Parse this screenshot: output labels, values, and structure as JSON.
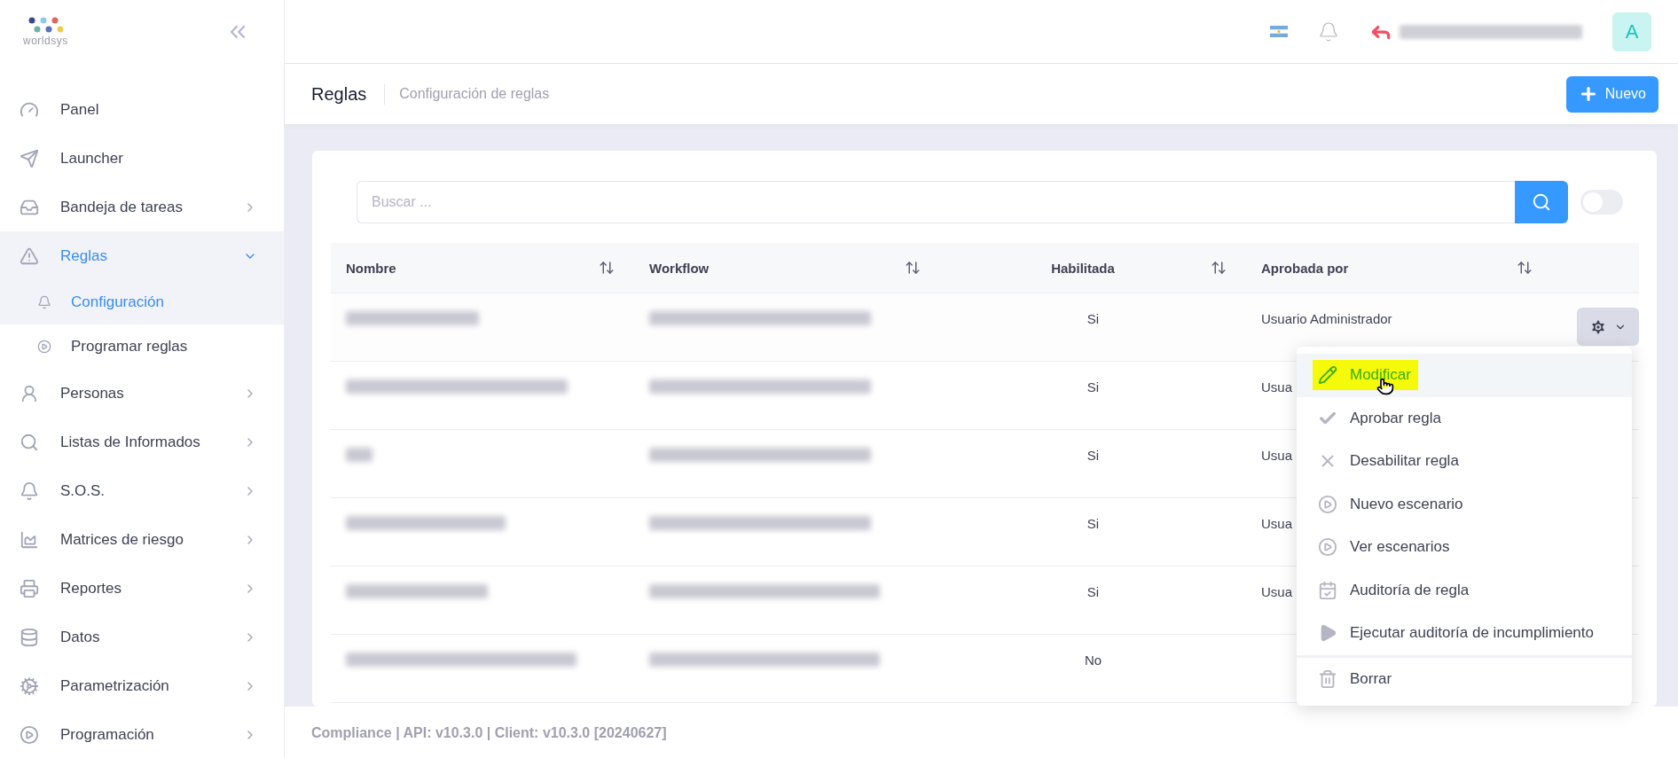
{
  "logo": {
    "text": "worldsys"
  },
  "sidebar": {
    "items": [
      {
        "label": "Panel",
        "expandable": false,
        "expanded": false,
        "selected": false
      },
      {
        "label": "Launcher",
        "expandable": false,
        "expanded": false,
        "selected": false
      },
      {
        "label": "Bandeja de tareas",
        "expandable": true,
        "expanded": false,
        "selected": false
      },
      {
        "label": "Reglas",
        "expandable": true,
        "expanded": true,
        "selected": true,
        "children": [
          {
            "label": "Configuración",
            "selected": true
          },
          {
            "label": "Programar reglas",
            "selected": false
          }
        ]
      },
      {
        "label": "Personas",
        "expandable": true,
        "expanded": false,
        "selected": false
      },
      {
        "label": "Listas de Informados",
        "expandable": true,
        "expanded": false,
        "selected": false
      },
      {
        "label": "S.O.S.",
        "expandable": true,
        "expanded": false,
        "selected": false
      },
      {
        "label": "Matrices de riesgo",
        "expandable": true,
        "expanded": false,
        "selected": false
      },
      {
        "label": "Reportes",
        "expandable": true,
        "expanded": false,
        "selected": false
      },
      {
        "label": "Datos",
        "expandable": true,
        "expanded": false,
        "selected": false
      },
      {
        "label": "Parametrización",
        "expandable": true,
        "expanded": false,
        "selected": false
      },
      {
        "label": "Programación",
        "expandable": true,
        "expanded": false,
        "selected": false
      }
    ]
  },
  "header": {
    "avatar": "A"
  },
  "page": {
    "title": "Reglas",
    "subtitle": "Configuración de reglas",
    "new_button": "Nuevo"
  },
  "search": {
    "placeholder": "Buscar ...",
    "toggle_on": false
  },
  "table": {
    "columns": [
      "Nombre",
      "Workflow",
      "Habilitada",
      "Aprobada por"
    ],
    "rows": [
      {
        "habilitada": "Si",
        "aprobada": "Usuario Administrador",
        "hovered": true
      },
      {
        "habilitada": "Si",
        "aprobada": "Usua",
        "hovered": false
      },
      {
        "habilitada": "Si",
        "aprobada": "Usua",
        "hovered": false
      },
      {
        "habilitada": "Si",
        "aprobada": "Usua",
        "hovered": false
      },
      {
        "habilitada": "Si",
        "aprobada": "Usua",
        "hovered": false
      },
      {
        "habilitada": "No",
        "hovered": false
      }
    ]
  },
  "menu": {
    "groups": [
      [
        {
          "label": "Modificar",
          "selected": true
        },
        {
          "label": "Aprobar regla",
          "selected": false
        },
        {
          "label": "Desabilitar regla",
          "selected": false
        },
        {
          "label": "Nuevo escenario",
          "selected": false
        },
        {
          "label": "Ver escenarios",
          "selected": false
        },
        {
          "label": "Auditoría de regla",
          "selected": false
        },
        {
          "label": "Ejecutar auditoría de incumplimiento",
          "selected": false
        }
      ],
      [
        {
          "label": "Borrar",
          "selected": false
        }
      ]
    ]
  },
  "footer": "Compliance | API: v10.3.0 | Client: v10.3.0 [20240627]"
}
